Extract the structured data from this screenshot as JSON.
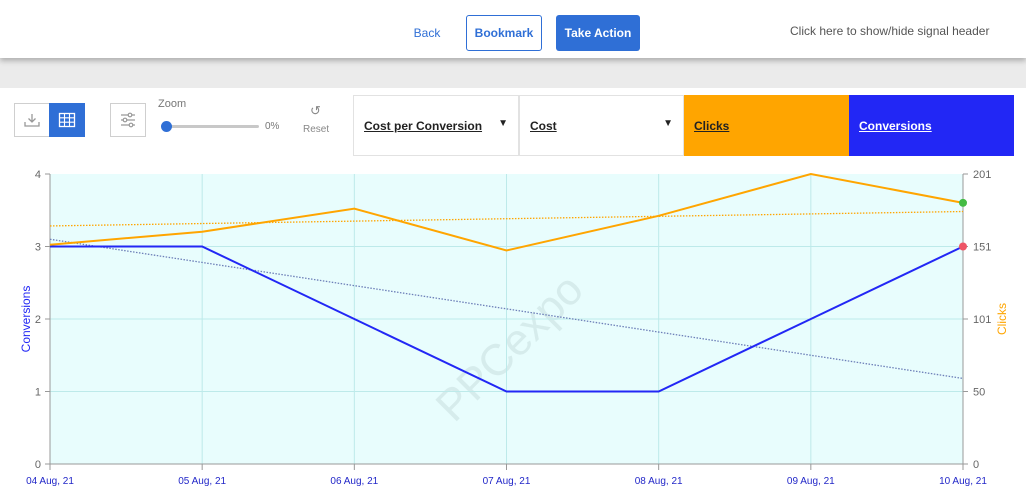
{
  "header": {
    "back_label": "Back",
    "bookmark_label": "Bookmark",
    "action_label": "Take Action",
    "signal_toggle_label": "Click here to show/hide signal header"
  },
  "toolbar": {
    "icons": [
      "download-icon",
      "table-icon",
      "sliders-icon",
      "reset-icon"
    ],
    "zoom_label": "Zoom",
    "zoom_value": "0%",
    "zoom_level": 0,
    "reset_label": "Reset",
    "metric_selectors": [
      {
        "label": "Cost per Conversion",
        "has_dropdown": true,
        "color": "#ffffff"
      },
      {
        "label": "Cost",
        "has_dropdown": true,
        "color": "#ffffff"
      },
      {
        "label": "Clicks",
        "has_dropdown": false,
        "color": "#ffa500"
      },
      {
        "label": "Conversions",
        "has_dropdown": false,
        "color": "#2227f5"
      }
    ]
  },
  "colors": {
    "accent": "#2f6fd6",
    "clicks": "#ffa500",
    "conversions": "#2227f5",
    "plot_background": "#e8fdfd"
  },
  "chart_data": {
    "type": "line",
    "watermark": "PPCexpo",
    "x": [
      "04 Aug, 21",
      "05 Aug, 21",
      "06 Aug, 21",
      "07 Aug, 21",
      "08 Aug, 21",
      "09 Aug, 21",
      "10 Aug, 21"
    ],
    "series": [
      {
        "name": "Conversions",
        "axis": "left",
        "color": "#2227f5",
        "values": [
          3,
          3,
          2,
          1,
          1,
          2,
          3
        ]
      },
      {
        "name": "Clicks",
        "axis": "right",
        "color": "#ffa500",
        "values": [
          152,
          161,
          177,
          148,
          172,
          201,
          181
        ]
      }
    ],
    "trendlines": [
      {
        "series": "Conversions",
        "axis": "left",
        "start": 3.1,
        "end": 1.18
      },
      {
        "series": "Clicks",
        "axis": "right",
        "start": 165,
        "end": 175
      }
    ],
    "ylabel_left": "Conversions",
    "ylabel_right": "Clicks",
    "ylim_left": [
      0,
      4
    ],
    "yticks_left": [
      "0",
      "1",
      "2",
      "3",
      "4"
    ],
    "ylim_right": [
      0,
      201
    ],
    "yticks_right": [
      "0",
      "50",
      "101",
      "151",
      "201"
    ],
    "grid": true
  }
}
